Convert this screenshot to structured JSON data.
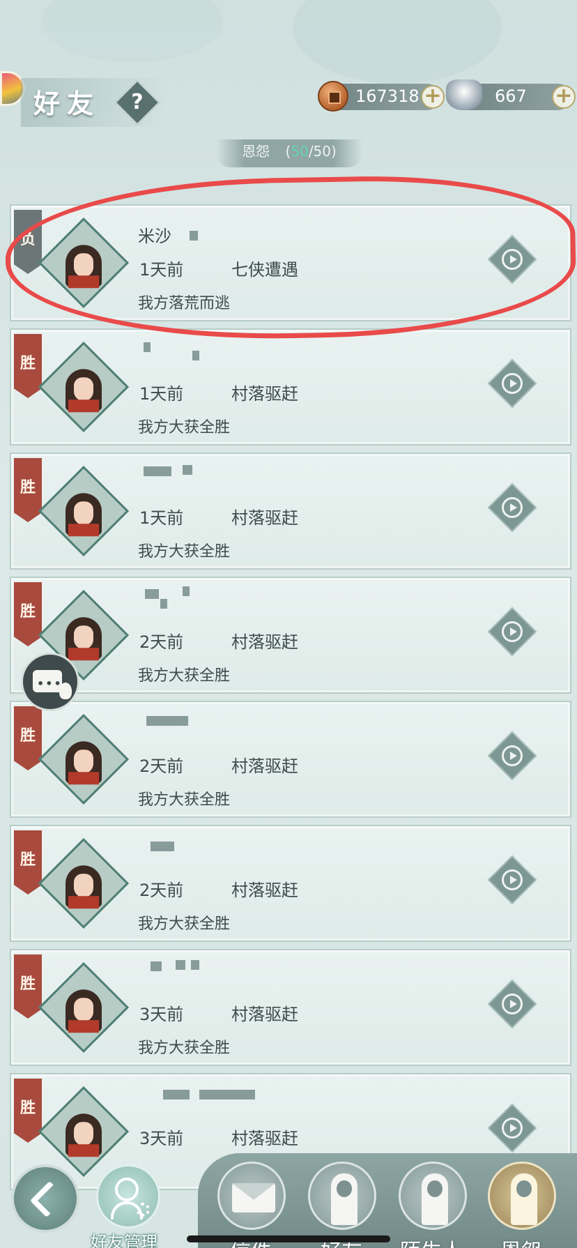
{
  "header": {
    "title": "好友",
    "help_label": "?",
    "copper": "167318",
    "silver": "667",
    "plus_label": "+",
    "tab_name": "恩怨",
    "count_current": "50",
    "count_max": "/50)",
    "count_open": "("
  },
  "records": [
    {
      "badge": "负",
      "time": "1天前",
      "event": "七侠遭遇",
      "result": "我方落荒而逃",
      "name": "米沙",
      "outcome": "lose"
    },
    {
      "badge": "胜",
      "time": "1天前",
      "event": "村落驱赶",
      "result": "我方大获全胜",
      "name": "",
      "outcome": "win"
    },
    {
      "badge": "胜",
      "time": "1天前",
      "event": "村落驱赶",
      "result": "我方大获全胜",
      "name": "",
      "outcome": "win"
    },
    {
      "badge": "胜",
      "time": "2天前",
      "event": "村落驱赶",
      "result": "我方大获全胜",
      "name": "",
      "outcome": "win"
    },
    {
      "badge": "胜",
      "time": "2天前",
      "event": "村落驱赶",
      "result": "我方大获全胜",
      "name": "",
      "outcome": "win"
    },
    {
      "badge": "胜",
      "time": "2天前",
      "event": "村落驱赶",
      "result": "我方大获全胜",
      "name": "",
      "outcome": "win"
    },
    {
      "badge": "胜",
      "time": "3天前",
      "event": "村落驱赶",
      "result": "我方大获全胜",
      "name": "",
      "outcome": "win"
    },
    {
      "badge": "胜",
      "time": "3天前",
      "event": "村落驱赶",
      "result": "",
      "name": "",
      "outcome": "win"
    }
  ],
  "bottom_nav": {
    "manage_label": "好友管理",
    "items": [
      {
        "label": "信件",
        "icon": "mail-icon"
      },
      {
        "label": "好友",
        "icon": "friend-icon"
      },
      {
        "label": "陌生人",
        "icon": "stranger-icon"
      },
      {
        "label": "恩怨",
        "icon": "grudge-icon"
      }
    ]
  },
  "colors": {
    "accent_green": "#63d4b3",
    "win_badge": "#a84a3e",
    "lose_badge": "#6d7676",
    "annotation_red": "#e94a4a"
  }
}
